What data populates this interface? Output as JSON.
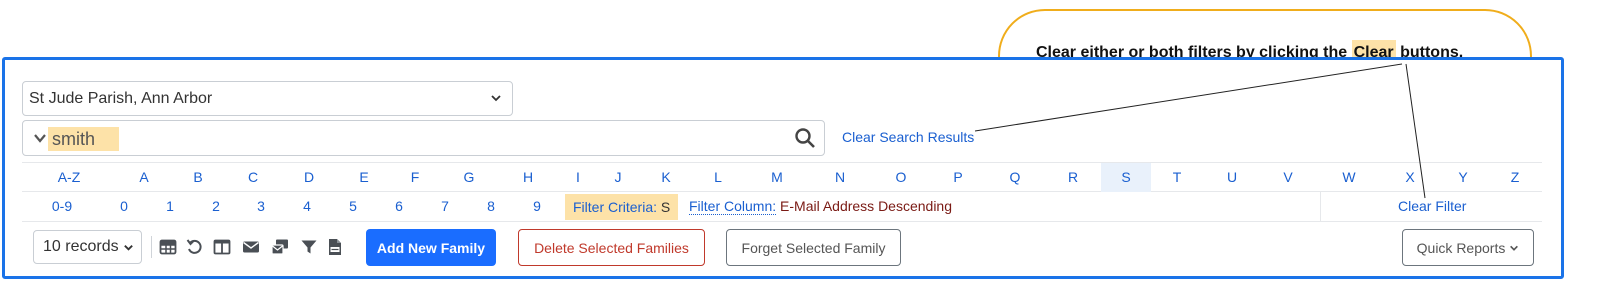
{
  "callout": {
    "text_before": "Clear either or both filters by clicking the ",
    "highlight": "Clear",
    "text_after": " buttons."
  },
  "parish_select": {
    "value": "St Jude Parish, Ann Arbor"
  },
  "search": {
    "value": "smith",
    "clear_label": "Clear Search Results"
  },
  "alpha_row": {
    "active": "S",
    "items": [
      "A-Z",
      "A",
      "B",
      "C",
      "D",
      "E",
      "F",
      "G",
      "H",
      "I",
      "J",
      "K",
      "L",
      "M",
      "N",
      "O",
      "P",
      "Q",
      "R",
      "S",
      "T",
      "U",
      "V",
      "W",
      "X",
      "Y",
      "Z"
    ]
  },
  "num_row": {
    "items": [
      "0-9",
      "0",
      "1",
      "2",
      "3",
      "4",
      "5",
      "6",
      "7",
      "8",
      "9"
    ],
    "filter_criteria_label": "Filter Criteria:",
    "filter_criteria_value": "S",
    "filter_column_label": "Filter Column:",
    "filter_column_value": "E-Mail Address Descending",
    "clear_filter_label": "Clear Filter"
  },
  "toolbar": {
    "records_select": "10 records",
    "icons": [
      "table-icon",
      "undo-icon",
      "columns-icon",
      "email-icon",
      "mail-merge-icon",
      "filter-icon",
      "csv-file-icon"
    ],
    "add_label": "Add New Family",
    "delete_label": "Delete Selected Families",
    "forget_label": "Forget Selected Family",
    "reports_label": "Quick Reports"
  },
  "colors": {
    "frame_border": "#1a73e8",
    "link": "#1a5fd0",
    "highlight": "#fde2a8",
    "callout_border": "#f0ad1b",
    "primary": "#1a6dff",
    "danger": "#c0392b"
  }
}
